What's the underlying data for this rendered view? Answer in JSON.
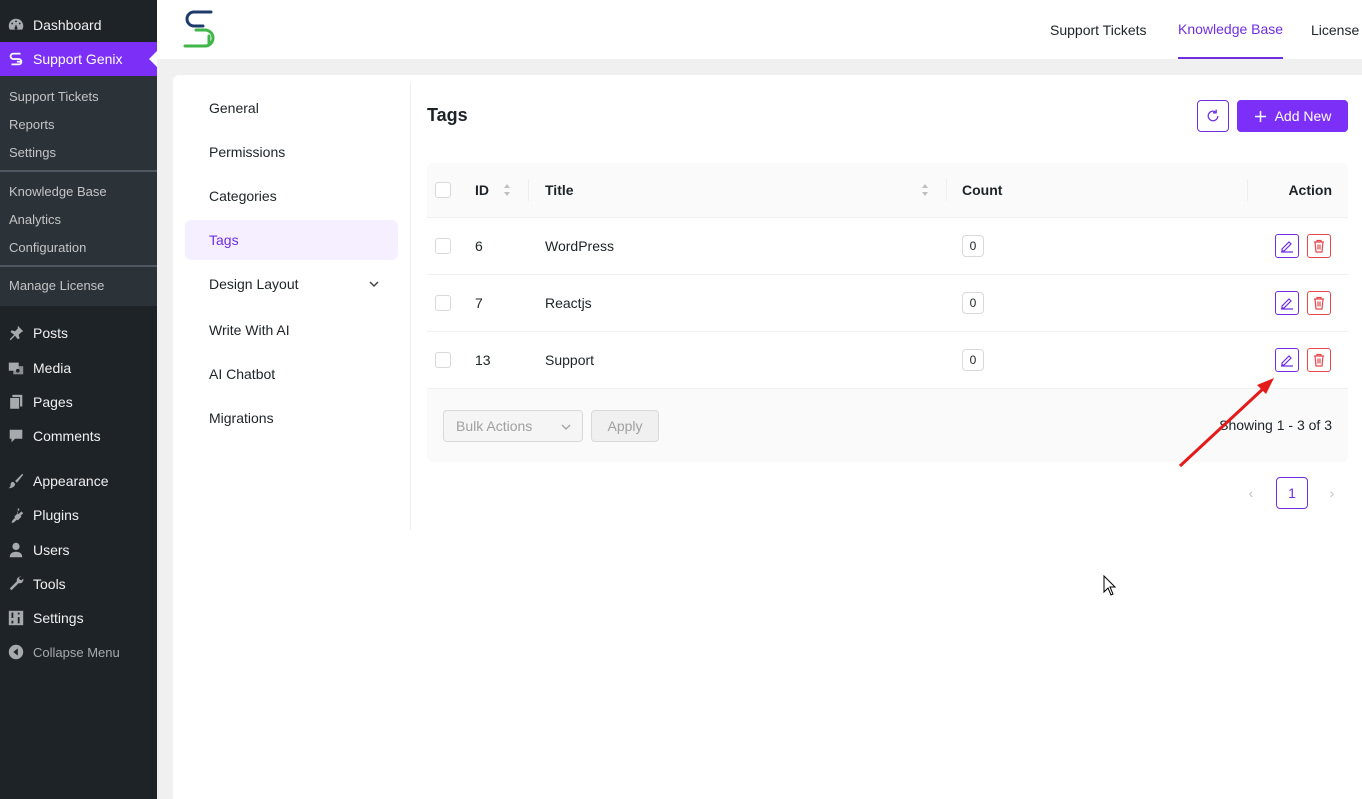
{
  "wp_sidebar": {
    "top_items": [
      {
        "label": "Dashboard",
        "icon": "dashboard-icon"
      },
      {
        "label": "Support Genix",
        "icon": "support-genix-icon"
      }
    ],
    "submenu": [
      "Support Tickets",
      "Reports",
      "Settings",
      "Knowledge Base",
      "Analytics",
      "Configuration",
      "Manage License"
    ],
    "items": [
      {
        "label": "Posts",
        "icon": "pin-icon"
      },
      {
        "label": "Media",
        "icon": "media-icon"
      },
      {
        "label": "Pages",
        "icon": "pages-icon"
      },
      {
        "label": "Comments",
        "icon": "comment-icon"
      },
      {
        "label": "Appearance",
        "icon": "brush-icon"
      },
      {
        "label": "Plugins",
        "icon": "plugin-icon"
      },
      {
        "label": "Users",
        "icon": "user-icon"
      },
      {
        "label": "Tools",
        "icon": "wrench-icon"
      },
      {
        "label": "Settings",
        "icon": "settings-sliders-icon"
      }
    ],
    "collapse_label": "Collapse Menu"
  },
  "topbar": {
    "nav": [
      "Support Tickets",
      "Knowledge Base",
      "License"
    ],
    "active": "Knowledge Base"
  },
  "subnav": {
    "items": [
      "General",
      "Permissions",
      "Categories",
      "Tags",
      "Design Layout",
      "Write With AI",
      "AI Chatbot",
      "Migrations"
    ],
    "active": "Tags"
  },
  "page": {
    "title": "Tags",
    "add_new_label": "Add New"
  },
  "table": {
    "headers": {
      "id": "ID",
      "title": "Title",
      "count": "Count",
      "action": "Action"
    },
    "rows": [
      {
        "id": "6",
        "title": "WordPress",
        "count": "0"
      },
      {
        "id": "7",
        "title": "Reactjs",
        "count": "0"
      },
      {
        "id": "13",
        "title": "Support",
        "count": "0"
      }
    ],
    "bulk_actions_placeholder": "Bulk Actions",
    "apply_label": "Apply",
    "showing": "Showing 1 - 3 of 3"
  },
  "pagination": {
    "prev": "‹",
    "current": "1",
    "next": "›"
  },
  "colors": {
    "accent": "#7b2ff7",
    "danger": "#e5484d",
    "annotation_arrow": "#e31b1b"
  }
}
